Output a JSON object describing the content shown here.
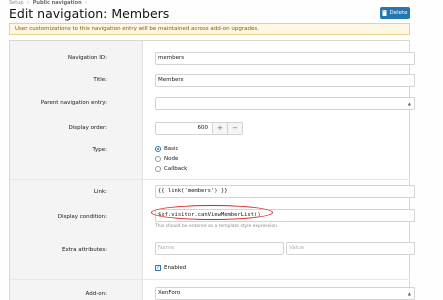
{
  "breadcrumb": [
    "Setup",
    "Public navigation"
  ],
  "breadcrumb_sep": "›",
  "page_title": "Edit navigation: Members",
  "delete_button": {
    "label": "Delete",
    "icon": "trash-icon"
  },
  "notice": "User customizations to this navigation entry will be maintained across add-on upgrades.",
  "form": {
    "nav_id": {
      "label": "Navigation ID:",
      "value": "members"
    },
    "title": {
      "label": "Title:",
      "value": "Members"
    },
    "parent": {
      "label": "Parent navigation entry:",
      "value": ""
    },
    "display_order": {
      "label": "Display order:",
      "value": "600",
      "plus": "+",
      "minus": "−"
    },
    "type": {
      "label": "Type:",
      "options": [
        "Basic",
        "Node",
        "Callback"
      ],
      "selected": "Basic"
    },
    "link": {
      "label": "Link:",
      "value": "{{ link('members') }}"
    },
    "display_condition": {
      "label": "Display condition:",
      "value": "$xf.visitor.canViewMemberList()",
      "hint": "This should be entered as a template style expression."
    },
    "extra_attributes": {
      "label": "Extra attributes:",
      "name_placeholder": "Name",
      "value_placeholder": "Value"
    },
    "enabled": {
      "label": "Enabled",
      "checked": true
    },
    "addon": {
      "label": "Add-on:",
      "value": "XenForo"
    }
  },
  "colors": {
    "accent": "#2577b1",
    "highlight_circle": "#d82020",
    "notice_bg": "#fdf7e4"
  }
}
